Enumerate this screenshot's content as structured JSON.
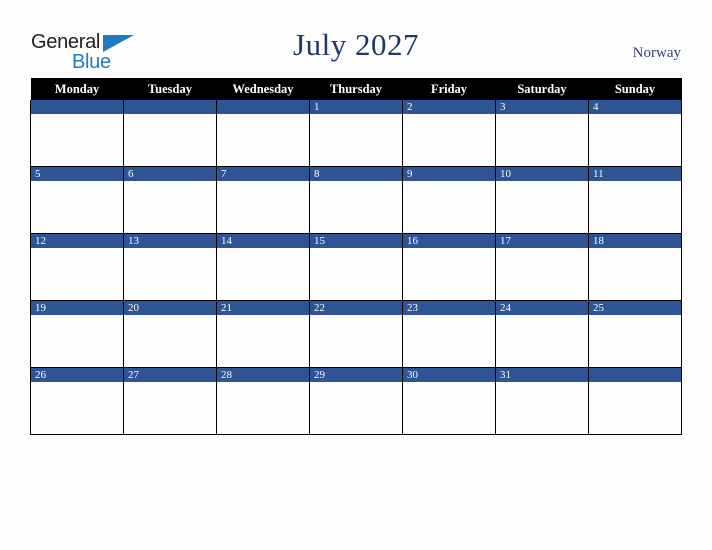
{
  "logo": {
    "word_one": "General",
    "word_two": "Blue",
    "triangle_icon": "triangle-icon",
    "brand_blue": "#1e7bc4",
    "brand_dark": "#231f20"
  },
  "header": {
    "title": "July 2027",
    "country": "Norway",
    "title_color": "#1f3864",
    "country_color": "#33456b"
  },
  "calendar": {
    "accent_color": "#2e5496",
    "header_bg": "#000000",
    "header_text_color": "#ffffff",
    "weekday_headers": [
      "Monday",
      "Tuesday",
      "Wednesday",
      "Thursday",
      "Friday",
      "Saturday",
      "Sunday"
    ],
    "weeks": [
      [
        "",
        "",
        "",
        "1",
        "2",
        "3",
        "4"
      ],
      [
        "5",
        "6",
        "7",
        "8",
        "9",
        "10",
        "11"
      ],
      [
        "12",
        "13",
        "14",
        "15",
        "16",
        "17",
        "18"
      ],
      [
        "19",
        "20",
        "21",
        "22",
        "23",
        "24",
        "25"
      ],
      [
        "26",
        "27",
        "28",
        "29",
        "30",
        "31",
        ""
      ]
    ]
  }
}
